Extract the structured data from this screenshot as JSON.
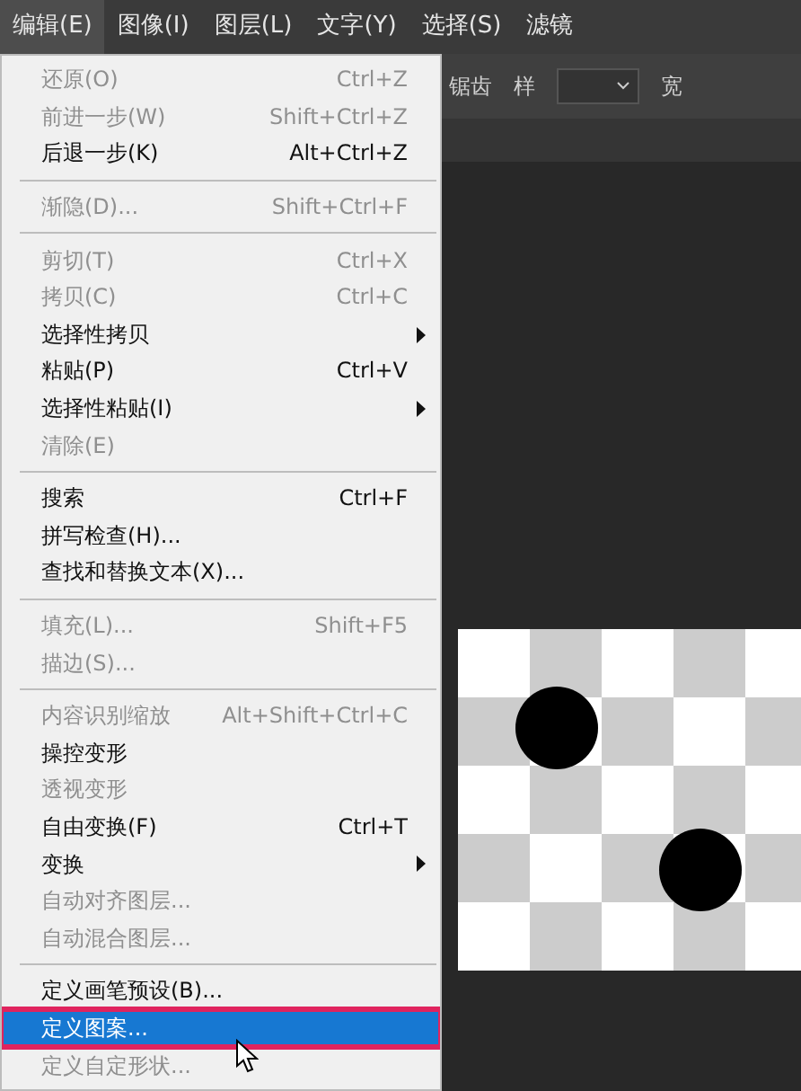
{
  "menubar": [
    {
      "label": "编辑(E)",
      "selected": true
    },
    {
      "label": "图像(I)",
      "selected": false
    },
    {
      "label": "图层(L)",
      "selected": false
    },
    {
      "label": "文字(Y)",
      "selected": false
    },
    {
      "label": "选择(S)",
      "selected": false
    },
    {
      "label": "滤镜",
      "selected": false
    }
  ],
  "toolbar": {
    "antialias_label": "锯齿",
    "style_label": "样",
    "width_label": "宽"
  },
  "menu": {
    "sections": [
      [
        {
          "label": "还原(O)",
          "shortcut": "Ctrl+Z",
          "disabled": true,
          "submenu": false,
          "selected": false,
          "annotated": false
        },
        {
          "label": "前进一步(W)",
          "shortcut": "Shift+Ctrl+Z",
          "disabled": true,
          "submenu": false,
          "selected": false,
          "annotated": false
        },
        {
          "label": "后退一步(K)",
          "shortcut": "Alt+Ctrl+Z",
          "disabled": false,
          "submenu": false,
          "selected": false,
          "annotated": false
        }
      ],
      [
        {
          "label": "渐隐(D)...",
          "shortcut": "Shift+Ctrl+F",
          "disabled": true,
          "submenu": false,
          "selected": false,
          "annotated": false
        }
      ],
      [
        {
          "label": "剪切(T)",
          "shortcut": "Ctrl+X",
          "disabled": true,
          "submenu": false,
          "selected": false,
          "annotated": false
        },
        {
          "label": "拷贝(C)",
          "shortcut": "Ctrl+C",
          "disabled": true,
          "submenu": false,
          "selected": false,
          "annotated": false
        },
        {
          "label": "选择性拷贝",
          "disabled": false,
          "submenu": true,
          "selected": false,
          "annotated": false
        },
        {
          "label": "粘贴(P)",
          "shortcut": "Ctrl+V",
          "disabled": false,
          "submenu": false,
          "selected": false,
          "annotated": false
        },
        {
          "label": "选择性粘贴(I)",
          "disabled": false,
          "submenu": true,
          "selected": false,
          "annotated": false
        },
        {
          "label": "清除(E)",
          "disabled": true,
          "submenu": false,
          "selected": false,
          "annotated": false
        }
      ],
      [
        {
          "label": "搜索",
          "shortcut": "Ctrl+F",
          "disabled": false,
          "submenu": false,
          "selected": false,
          "annotated": false
        },
        {
          "label": "拼写检查(H)...",
          "disabled": false,
          "submenu": false,
          "selected": false,
          "annotated": false
        },
        {
          "label": "查找和替换文本(X)...",
          "disabled": false,
          "submenu": false,
          "selected": false,
          "annotated": false
        }
      ],
      [
        {
          "label": "填充(L)...",
          "shortcut": "Shift+F5",
          "disabled": true,
          "submenu": false,
          "selected": false,
          "annotated": false
        },
        {
          "label": "描边(S)...",
          "disabled": true,
          "submenu": false,
          "selected": false,
          "annotated": false
        }
      ],
      [
        {
          "label": "内容识别缩放",
          "shortcut": "Alt+Shift+Ctrl+C",
          "disabled": true,
          "submenu": false,
          "selected": false,
          "annotated": false
        },
        {
          "label": "操控变形",
          "disabled": false,
          "submenu": false,
          "selected": false,
          "annotated": false
        },
        {
          "label": "透视变形",
          "disabled": true,
          "submenu": false,
          "selected": false,
          "annotated": false
        },
        {
          "label": "自由变换(F)",
          "shortcut": "Ctrl+T",
          "disabled": false,
          "submenu": false,
          "selected": false,
          "annotated": false
        },
        {
          "label": "变换",
          "disabled": false,
          "submenu": true,
          "selected": false,
          "annotated": false
        },
        {
          "label": "自动对齐图层...",
          "disabled": true,
          "submenu": false,
          "selected": false,
          "annotated": false
        },
        {
          "label": "自动混合图层...",
          "disabled": true,
          "submenu": false,
          "selected": false,
          "annotated": false
        }
      ],
      [
        {
          "label": "定义画笔预设(B)...",
          "disabled": false,
          "submenu": false,
          "selected": false,
          "annotated": false
        },
        {
          "label": "定义图案...",
          "disabled": false,
          "submenu": false,
          "selected": true,
          "annotated": true
        },
        {
          "label": "定义自定形状...",
          "disabled": true,
          "submenu": false,
          "selected": false,
          "annotated": false
        }
      ]
    ]
  }
}
